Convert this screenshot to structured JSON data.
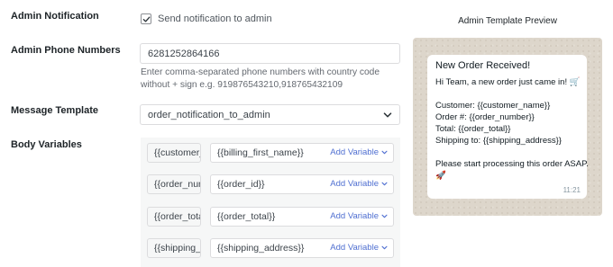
{
  "labels": {
    "admin_notification": "Admin Notification",
    "admin_phone_numbers": "Admin Phone Numbers",
    "message_template": "Message Template",
    "body_variables": "Body Variables"
  },
  "notification": {
    "checked": true,
    "label": "Send notification to admin"
  },
  "phone": {
    "value": "6281252864166",
    "help": "Enter comma-separated phone numbers with country code without + sign e.g. 919876543210,918765432109"
  },
  "template": {
    "selected": "order_notification_to_admin"
  },
  "body_variables": [
    {
      "name": "{{customer_name}}",
      "value": "{{billing_first_name}}",
      "action": "Add Variable"
    },
    {
      "name": "{{order_number}}",
      "value": "{{order_id}}",
      "action": "Add Variable"
    },
    {
      "name": "{{order_total}}",
      "value": "{{order_total}}",
      "action": "Add Variable"
    },
    {
      "name": "{{shipping_address}}",
      "value": "{{shipping_address}}",
      "action": "Add Variable"
    }
  ],
  "preview": {
    "title": "Admin Template Preview",
    "heading": "New Order Received!",
    "intro": "Hi Team, a new order just came in! 🛒",
    "customer": "Customer: {{customer_name}}",
    "order": "Order #: {{order_number}}",
    "total": "Total: {{order_total}}",
    "shipping": "Shipping to: {{shipping_address}}",
    "outro": "Please start processing this order ASAP.",
    "outro_emoji": "🚀",
    "time": "11:21"
  },
  "colors": {
    "accent": "#4f6fd1",
    "preview_bg": "#ddd6cb",
    "bubble": "#ffffff"
  }
}
